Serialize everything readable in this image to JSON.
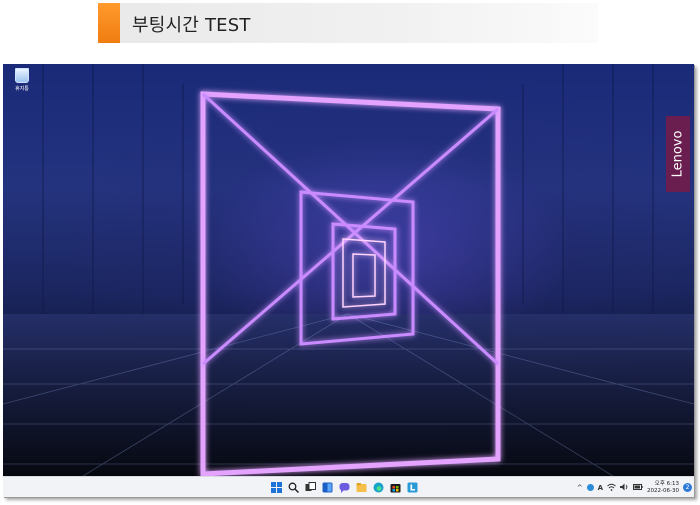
{
  "header": {
    "title": "부팅시간 TEST"
  },
  "desktop": {
    "recycle_bin_label": "휴지통",
    "brand_badge": "Lenovo"
  },
  "taskbar": {
    "icons": [
      "windows-start-icon",
      "search-icon",
      "task-view-icon",
      "widgets-icon",
      "chat-icon",
      "file-explorer-icon",
      "edge-icon",
      "store-icon",
      "lenovo-vantage-icon"
    ],
    "tray": {
      "ime": "A",
      "time": "오후 6:13",
      "date": "2022-06-30",
      "notification_count": "2"
    }
  },
  "colors": {
    "header_accent": "#f07d10",
    "taskbar_bg": "#f1f3f7",
    "neon": "#d27cff",
    "lenovo_badge": "#6a1e4f"
  }
}
